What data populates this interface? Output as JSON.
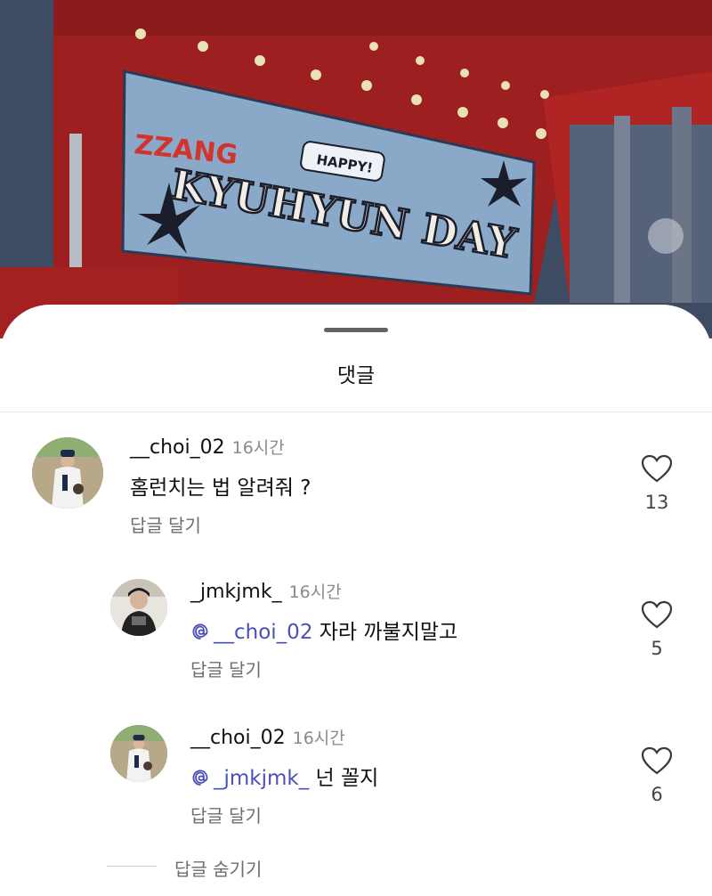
{
  "banner": {
    "brand": "ZZANG",
    "bubble": "HAPPY!",
    "headline": "KYUHYUN DAY"
  },
  "sheet": {
    "title": "댓글",
    "hide_replies": "답글 숨기기"
  },
  "comments": [
    {
      "username": "__choi_02",
      "time": "16시간",
      "mention": "",
      "text": "홈런치는 법 알려줘 ?",
      "reply_label": "답글 달기",
      "likes": "13"
    },
    {
      "username": "_jmkjmk_",
      "time": "16시간",
      "mention": "__choi_02",
      "text": "자라 까불지말고",
      "reply_label": "답글 달기",
      "likes": "5"
    },
    {
      "username": "__choi_02",
      "time": "16시간",
      "mention": "_jmkjmk_",
      "text": "넌 꼴지",
      "reply_label": "답글 달기",
      "likes": "6"
    }
  ],
  "colors": {
    "mention": "#4a52b8",
    "banner_red": "#b3201f",
    "banner_blue": "#8aa9c9"
  },
  "icons": [
    "heart-icon",
    "threads-icon",
    "avatar-baseball-player",
    "avatar-person"
  ]
}
